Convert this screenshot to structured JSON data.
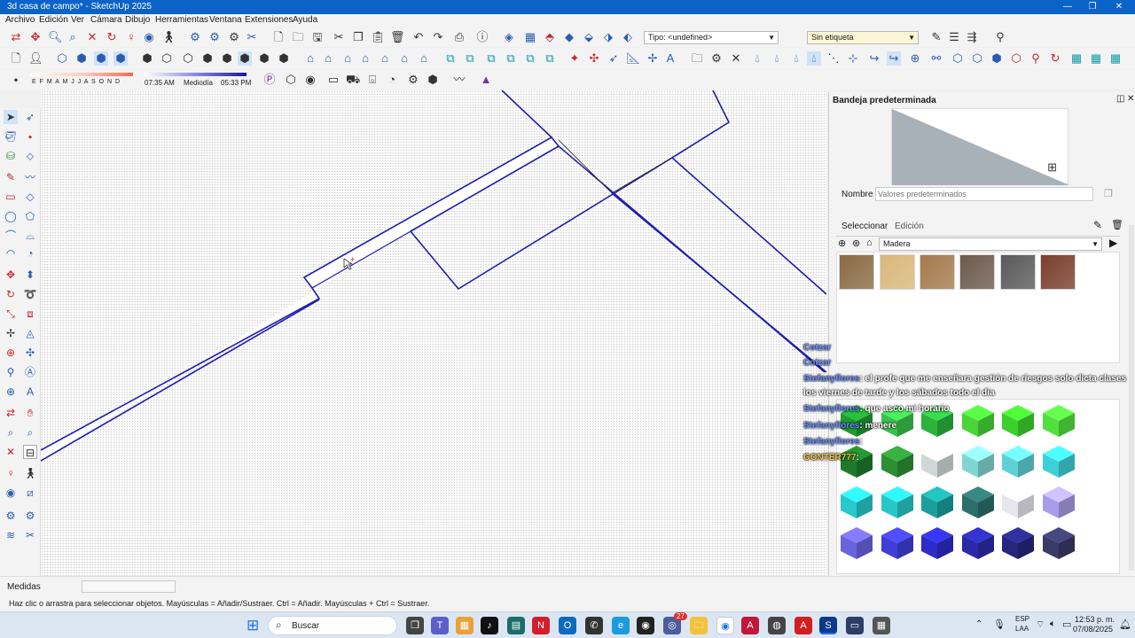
{
  "window": {
    "title": "3d casa de campo* - SketchUp 2025",
    "minimize": "—",
    "restore": "❐",
    "close": "✕"
  },
  "menu": [
    "Archivo",
    "Edición",
    "Ver",
    "Cámara",
    "Dibujo",
    "Herramientas",
    "Ventana",
    "Extensiones",
    "Ayuda"
  ],
  "toolbar": {
    "tag_type_label": "Tipo: <undefined>",
    "tag_label": "Sin etiqueta",
    "months": "E F M A M J J A S O N D",
    "time_start": "07:35 AM",
    "time_mid": "Mediodía",
    "time_end": "05:33 PM"
  },
  "tray": {
    "title": "Bandeja predeterminada",
    "name_label": "Nombre",
    "name_placeholder": "Valores predeterminados",
    "tab_select": "Seleccionar",
    "tab_edit": "Edición",
    "library": "Madera",
    "wood_colors": [
      "#8a6a44",
      "#d9b87a",
      "#a57a4e",
      "#6d5a4c",
      "#5a5a5a",
      "#7a3f2c"
    ],
    "color_rows": [
      [
        "#1f9b30",
        "#3ac04a",
        "#2cb33c",
        "#48d43a",
        "#3ecf2e",
        "#52e040"
      ],
      [
        "#1d7a2a",
        "#2d8f34",
        "#cfd8d8",
        "#7fd6d0",
        "#5ed0d8",
        "#3dd0d8"
      ],
      [
        "#27c9cc",
        "#29c6c8",
        "#1c9e9c",
        "#2b6e6a",
        "#e6e6ee",
        "#a89be8"
      ],
      [
        "#6a63e0",
        "#3f3fd8",
        "#2c2cc8",
        "#2a2aa8",
        "#26267e",
        "#3a3a66"
      ]
    ]
  },
  "chat": [
    {
      "user": "Cotzar",
      "text": ""
    },
    {
      "user": "Cotzar",
      "text": ""
    },
    {
      "user": "Stefanyflores",
      "text": ": el profe que me enseñara gestión de riesgos solo dicta clases"
    },
    {
      "user": "",
      "text": "los viernes de tarde y los sábados todo el dia"
    },
    {
      "user": "Stefanyflores",
      "text": ": que asco mi horario"
    },
    {
      "user": "Stefanyflores",
      "text": ": menere"
    },
    {
      "user": "Stefanyflores",
      "text": ":"
    },
    {
      "user": "GONTER777",
      "text": ":"
    }
  ],
  "status": {
    "measures_label": "Medidas",
    "hint": "Haz clic o arrastra para seleccionar objetos. Mayúsculas = Añadir/Sustraer. Ctrl = Añadir. Mayúsculas + Ctrl = Sustraer."
  },
  "taskbar": {
    "search": "Buscar",
    "lang": "ESP",
    "lang2": "LAA",
    "time": "12:53 p. m.",
    "date": "07/08/2025",
    "badge": "27"
  }
}
